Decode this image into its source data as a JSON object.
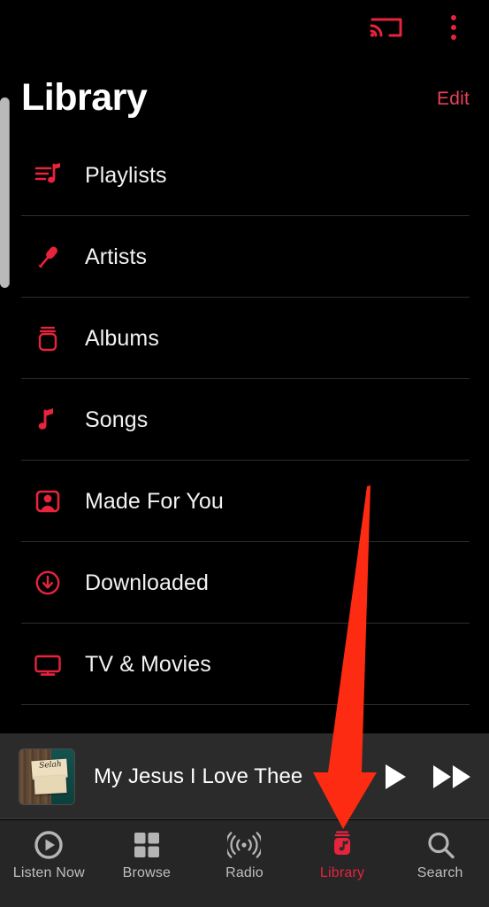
{
  "app": {
    "screen_title": "Library",
    "accent_color": "#e8233c",
    "background_color": "#000000"
  },
  "topbar": {
    "cast_icon": "cast-icon",
    "overflow_icon": "more-vertical-icon"
  },
  "header": {
    "title": "Library",
    "edit_label": "Edit"
  },
  "library_items": [
    {
      "label": "Playlists",
      "icon": "playlist-music-icon"
    },
    {
      "label": "Artists",
      "icon": "microphone-icon"
    },
    {
      "label": "Albums",
      "icon": "album-stack-icon"
    },
    {
      "label": "Songs",
      "icon": "music-note-icon"
    },
    {
      "label": "Made For You",
      "icon": "person-portrait-icon"
    },
    {
      "label": "Downloaded",
      "icon": "download-circle-icon"
    },
    {
      "label": "TV & Movies",
      "icon": "tv-monitor-icon"
    }
  ],
  "now_playing": {
    "track_title": "My Jesus I Love Thee",
    "album_art_text": "Selah",
    "play_icon": "play-icon",
    "next_icon": "fast-forward-icon"
  },
  "tabs": [
    {
      "label": "Listen Now",
      "icon": "play-circle-icon",
      "active": false
    },
    {
      "label": "Browse",
      "icon": "grid-squares-icon",
      "active": false
    },
    {
      "label": "Radio",
      "icon": "broadcast-icon",
      "active": false
    },
    {
      "label": "Library",
      "icon": "library-icon",
      "active": true
    },
    {
      "label": "Search",
      "icon": "search-icon",
      "active": false
    }
  ],
  "annotation": {
    "arrow_color": "#fc2b12",
    "points_to": "Library"
  }
}
